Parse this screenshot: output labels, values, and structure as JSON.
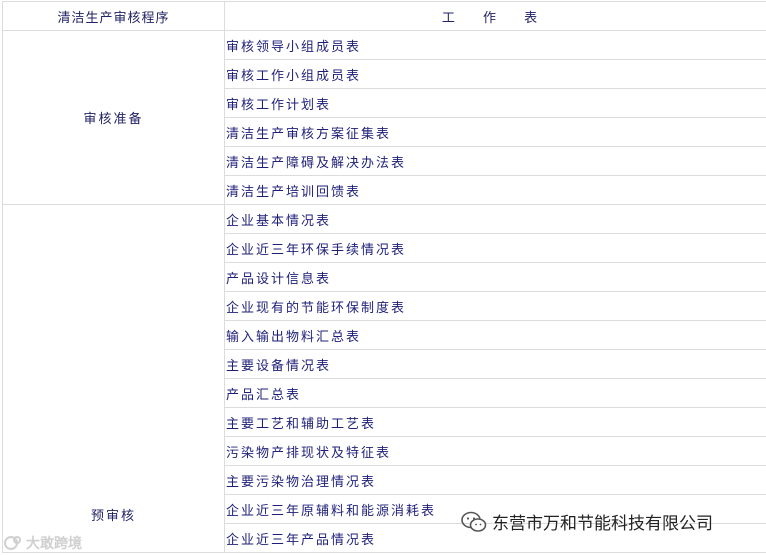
{
  "header": {
    "stage": "清洁生产审核程序",
    "form": "工 作 表"
  },
  "groups": [
    {
      "stage": "审核准备",
      "forms": [
        "审核领导小组成员表",
        "审核工作小组成员表",
        "审核工作计划表",
        "清洁生产审核方案征集表",
        "清洁生产障碍及解决办法表",
        "清洁生产培训回馈表"
      ]
    },
    {
      "stage": "预审核",
      "forms": [
        "企业基本情况表",
        "企业近三年环保手续情况表",
        "产品设计信息表",
        "企业现有的节能环保制度表",
        "输入输出物料汇总表",
        "主要设备情况表",
        "产品汇总表",
        "主要工艺和辅助工艺表",
        "污染物产排现状及特征表",
        "主要污染物治理情况表",
        "企业近三年原辅料和能源消耗表",
        "企业近三年产品情况表"
      ]
    }
  ],
  "watermarks": {
    "left": "大敢跨境",
    "right": "东营市万和节能科技有限公司"
  }
}
